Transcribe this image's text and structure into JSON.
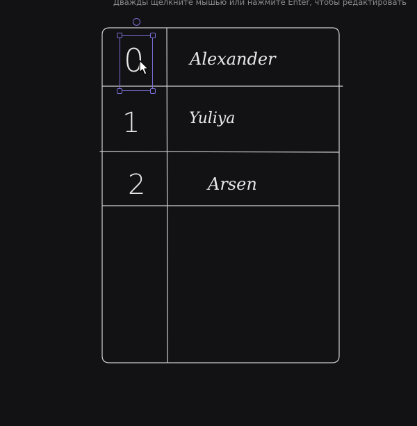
{
  "hint_text": "Дважды щелкните мышью или нажмите Enter, чтобы редактировать",
  "table": {
    "rows": [
      {
        "index": "0",
        "name": "Alexander"
      },
      {
        "index": "1",
        "name": "Yuliya"
      },
      {
        "index": "2",
        "name": "Arsen"
      },
      {
        "index": "",
        "name": ""
      }
    ]
  },
  "colors": {
    "background": "#121214",
    "stroke": "#d0d0d0",
    "selection": "#7b6fd6",
    "text": "#e8e8e8"
  },
  "selection": {
    "selected_element": "0"
  },
  "icons": {
    "cursor": "pointer-cursor-icon",
    "rotate_handle": "rotate-handle-icon"
  }
}
